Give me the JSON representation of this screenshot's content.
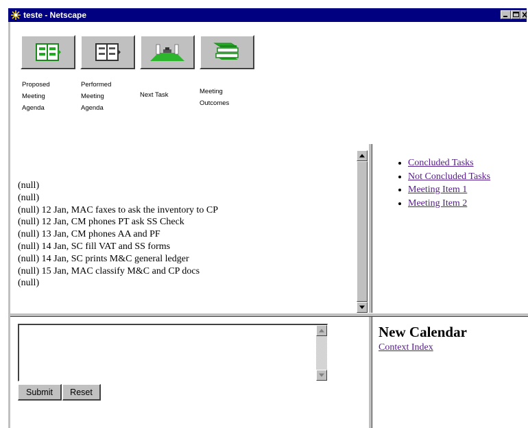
{
  "window": {
    "title": "teste - Netscape",
    "icon": "netscape-star-icon",
    "controls": [
      "minimize-icon",
      "maximize-icon",
      "close-icon"
    ]
  },
  "toolbar": {
    "buttons": [
      {
        "icon": "open-agenda-book-icon",
        "label": "Proposed\nMeeting\nAgenda"
      },
      {
        "icon": "closed-agenda-book-icon",
        "label": "Performed\nMeeting\nAgenda"
      },
      {
        "icon": "next-task-scene-icon",
        "label": "Next Task"
      },
      {
        "icon": "stacked-books-icon",
        "label": "Meeting\nOutcomes"
      }
    ]
  },
  "task_list": {
    "lines": [
      "(null)",
      "(null)",
      "(null) 12 Jan, MAC faxes to ask the inventory to CP",
      "(null) 12 Jan, CM phones PT ask SS Check",
      "(null) 13 Jan, CM phones AA and PF",
      "(null) 14 Jan, SC fill VAT and SS forms",
      "(null) 14 Jan, SC prints M&C general ledger",
      "(null) 15 Jan, MAC classify M&C and CP docs",
      "(null)"
    ]
  },
  "links": {
    "items": [
      "Concluded Tasks",
      "Not Concluded Tasks",
      "Meeting Item 1",
      "Meeting Item 2"
    ]
  },
  "form": {
    "textarea_value": "",
    "submit_label": "Submit",
    "reset_label": "Reset"
  },
  "calendar": {
    "title": "New Calendar",
    "context_link": "Context Index"
  },
  "colors": {
    "titlebar": "#000080",
    "chrome": "#c0c0c0",
    "visited_link": "#551a8b",
    "icon_green": "#22aa22"
  }
}
